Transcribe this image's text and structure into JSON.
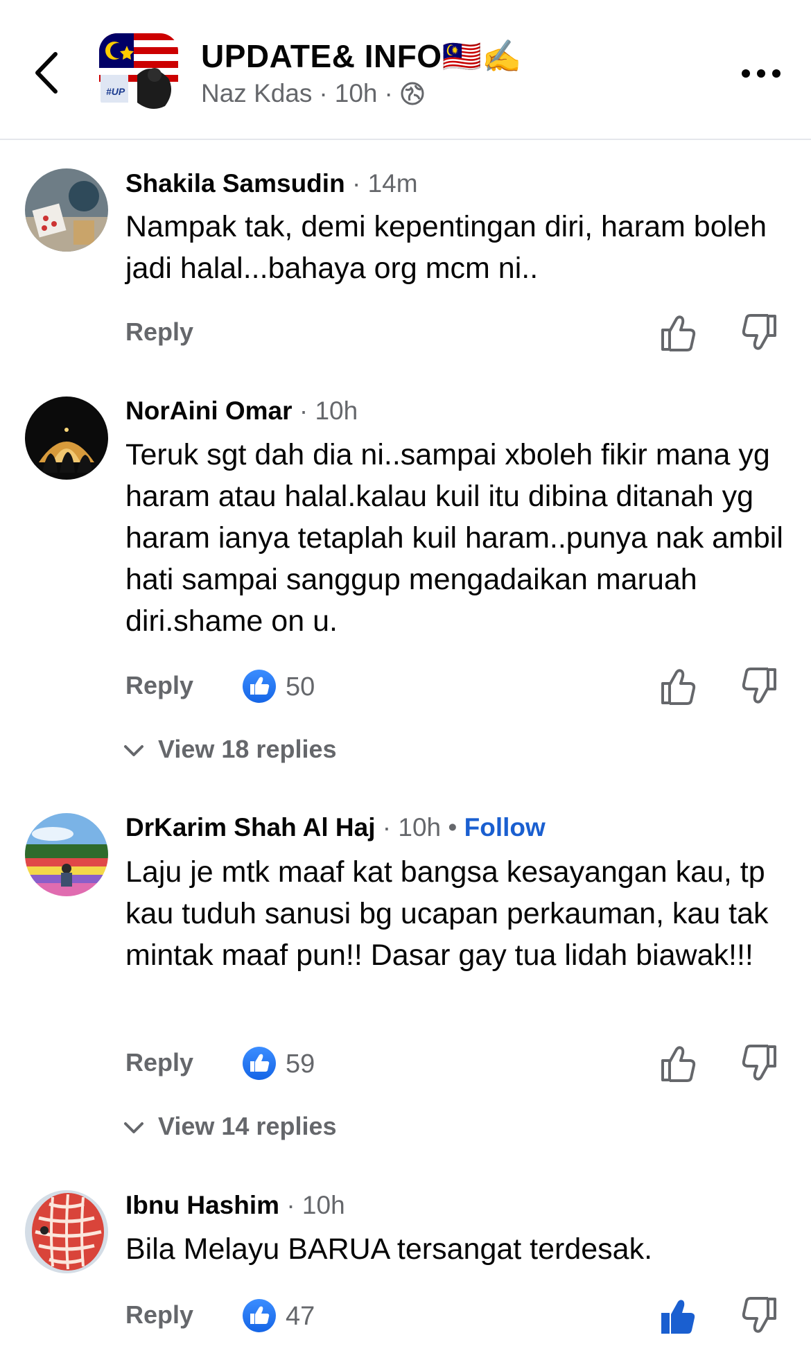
{
  "header": {
    "title": "UPDATE& INFO",
    "title_emoji": "🇲🇾✍️",
    "author": "Naz Kdas",
    "time": "10h",
    "avatar_badge": "#UP",
    "back_icon": "chevron-left-icon",
    "more_icon": "more-horizontal-icon",
    "privacy_icon": "globe-icon"
  },
  "colors": {
    "accent_blue": "#1a5fd0",
    "muted_gray": "#65676b",
    "text": "#050505",
    "like_blue": "#1565e6"
  },
  "comments": [
    {
      "author": "Shakila Samsudin",
      "time": "14m",
      "text": "Nampak tak, demi kepentingan diri, haram boleh jadi halal...bahaya org mcm ni..",
      "reply_label": "Reply",
      "reaction_count": null,
      "liked": false
    },
    {
      "author": "NorAini Omar",
      "time": "10h",
      "text": "Teruk sgt dah dia ni..sampai xboleh fikir mana yg haram atau halal.kalau kuil itu dibina ditanah yg haram ianya tetaplah kuil haram..punya nak ambil hati sampai sanggup mengadaikan maruah diri.shame on u.",
      "reply_label": "Reply",
      "reaction_count": "50",
      "view_replies": "View 18 replies",
      "liked": false
    },
    {
      "author": "DrKarim Shah Al Haj",
      "time": "10h",
      "follow_label": "Follow",
      "text": "Laju je mtk maaf kat bangsa kesayangan kau, tp kau tuduh sanusi bg ucapan perkauman, kau tak mintak maaf pun!! Dasar gay tua lidah biawak!!!",
      "reply_label": "Reply",
      "reaction_count": "59",
      "view_replies": "View 14 replies",
      "liked": false
    },
    {
      "author": "Ibnu Hashim",
      "time": "10h",
      "text": "Bila Melayu BARUA tersangat terdesak.",
      "reply_label": "Reply",
      "reaction_count": "47",
      "liked": true
    }
  ]
}
